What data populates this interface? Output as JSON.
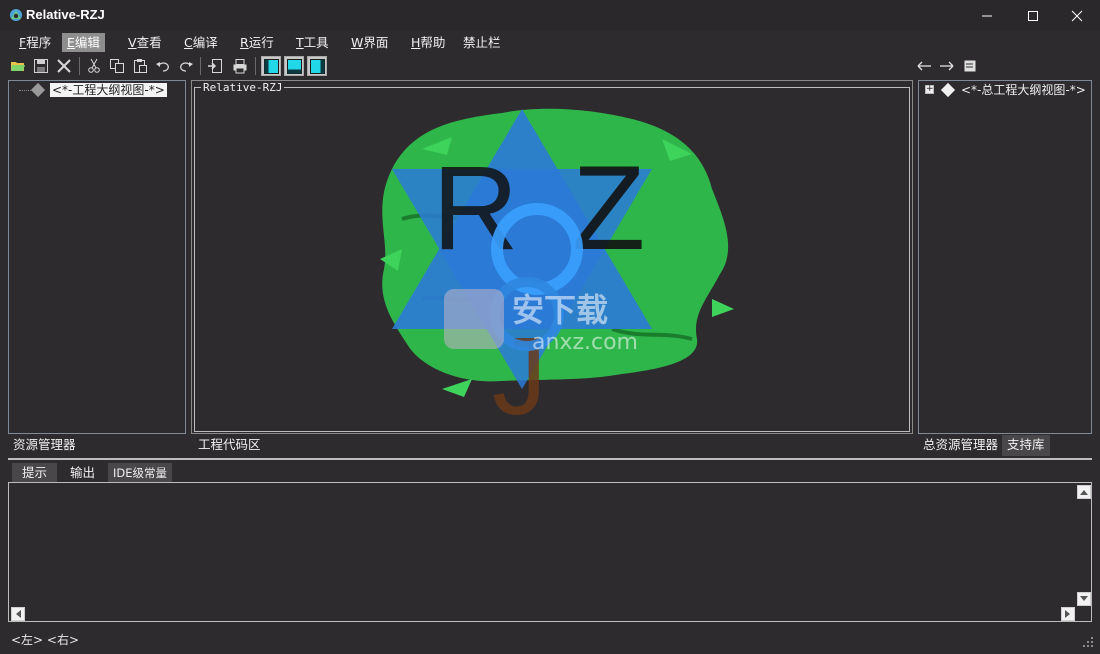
{
  "window": {
    "title": "Relative-RZJ"
  },
  "menu": [
    {
      "key": "F",
      "label": "程序"
    },
    {
      "key": "E",
      "label": "编辑",
      "active": true
    },
    {
      "key": "V",
      "label": "查看"
    },
    {
      "key": "C",
      "label": "编译"
    },
    {
      "key": "R",
      "label": "运行"
    },
    {
      "key": "T",
      "label": "工具"
    },
    {
      "key": "W",
      "label": "界面"
    },
    {
      "key": "H",
      "label": "帮助"
    },
    {
      "key": "",
      "label": "禁止栏"
    }
  ],
  "toolbar_icons": [
    "open-folder-icon",
    "save-icon",
    "close-icon",
    "cut-icon",
    "copy-icon",
    "paste-icon",
    "undo-icon",
    "redo-icon",
    "import-icon",
    "print-icon",
    "layout-left-icon",
    "layout-bottom-icon",
    "layout-right-icon",
    "back-arrow-icon",
    "forward-arrow-icon",
    "properties-icon"
  ],
  "left_panel": {
    "tree_root": "<*-工程大纲视图-*>",
    "tab": "资源管理器"
  },
  "center_panel": {
    "group_title": "Relative-RZJ",
    "logo_letters": "RZJ",
    "watermark_text": "anxz.com",
    "tab": "工程代码区"
  },
  "right_panel": {
    "tree_root": "<*-总工程大纲视图-*>",
    "expander": "+",
    "tabs": [
      "总资源管理器",
      "支持库"
    ]
  },
  "bottom_panel": {
    "tabs": [
      "提示",
      "输出",
      "IDE级常量"
    ]
  },
  "status": {
    "text": "<左> <右>"
  },
  "colors": {
    "background": "#2e2b2e",
    "panel_border": "#7e8a98",
    "layout_button_cyan": "#21d7e8",
    "logo_green": "#2fb64a",
    "logo_blue": "#2c7ad8"
  }
}
